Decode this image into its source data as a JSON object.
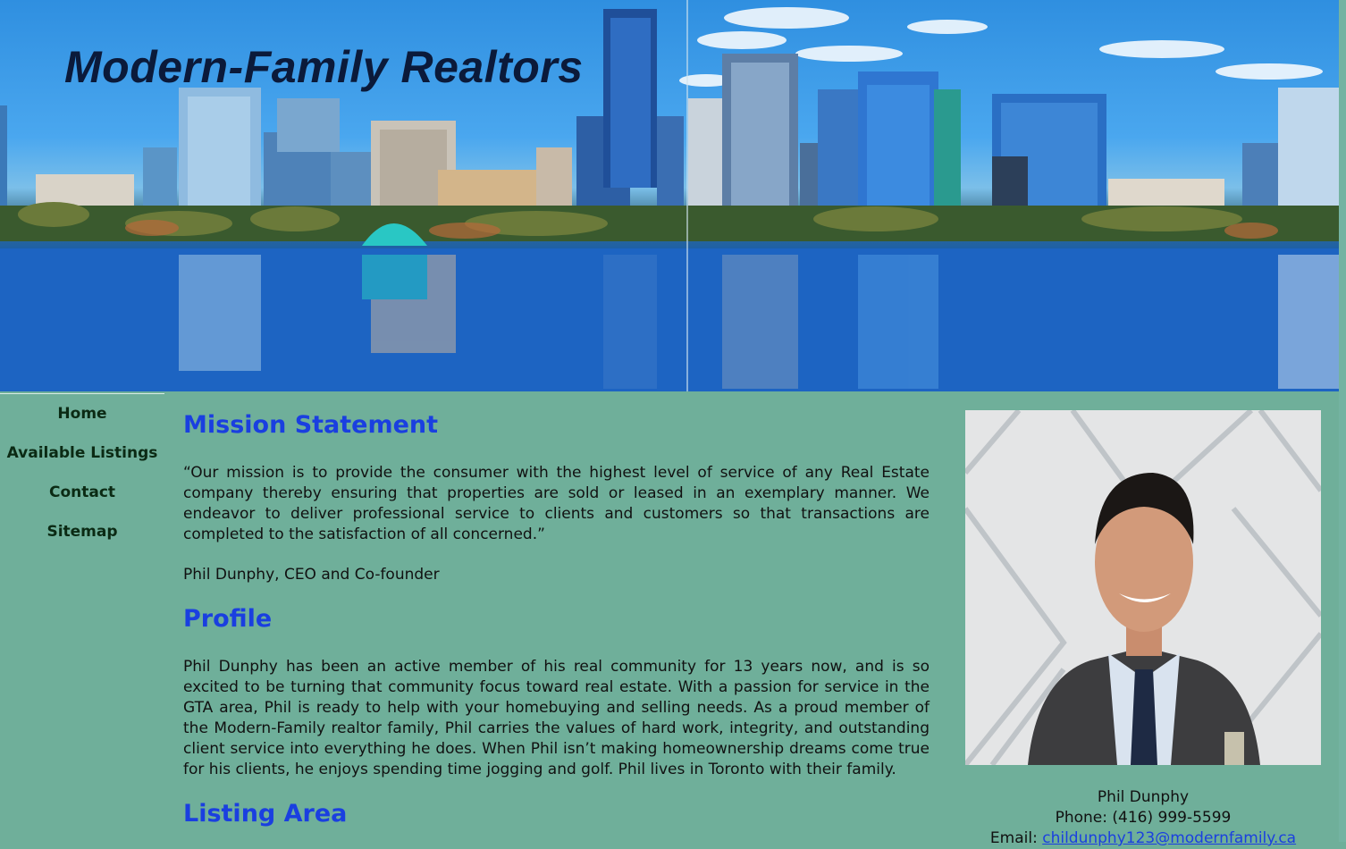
{
  "site": {
    "title": "Modern-Family Realtors"
  },
  "nav": {
    "items": [
      {
        "label": "Home"
      },
      {
        "label": "Available Listings"
      },
      {
        "label": "Contact"
      },
      {
        "label": "Sitemap"
      }
    ]
  },
  "main": {
    "mission": {
      "title": "Mission Statement",
      "text": "“Our mission is to provide the consumer with the highest level of service of any Real Estate company thereby ensuring that properties are sold or leased in an exemplary manner. We endeavor to deliver professional service to clients and customers so that transactions are completed to the satisfaction of all concerned.”",
      "signature": "Phil Dunphy, CEO and Co-founder"
    },
    "profile": {
      "title": "Profile",
      "text": "Phil Dunphy has been an active member of his real community for 13 years now, and is so excited to be turning that community focus toward real estate. With a passion for service in the GTA area, Phil is ready to help with your homebuying and selling needs. As a proud member of the Modern-Family realtor family, Phil carries the values of hard work, integrity, and outstanding client service into everything he does. When Phil isn’t making homeownership dreams come true for his clients, he enjoys spending time jogging and golf. Phil lives in Toronto with their family."
    },
    "listing": {
      "title": "Listing Area"
    }
  },
  "agent": {
    "name": "Phil Dunphy",
    "phone_label": "Phone:",
    "phone": "(416) 999-5599",
    "email_label": "Email:",
    "email": "childunphy123@modernfamily.ca"
  },
  "colors": {
    "page_background": "#6faf9a",
    "heading": "#1a3fe0",
    "nav_text": "#0b2a14",
    "title_text": "#0b1a3a"
  }
}
